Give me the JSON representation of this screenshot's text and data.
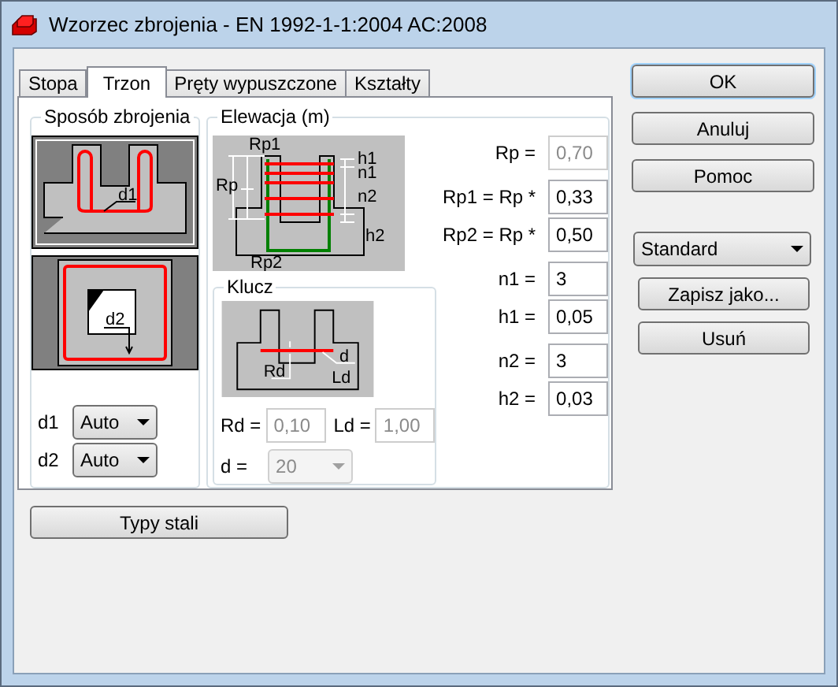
{
  "window": {
    "title": "Wzorzec zbrojenia - EN 1992-1-1:2004 AC:2008"
  },
  "tabs": [
    {
      "label": "Stopa",
      "selected": false
    },
    {
      "label": "Trzon",
      "selected": true
    },
    {
      "label": "Pręty wypuszczone",
      "selected": false
    },
    {
      "label": "Kształty",
      "selected": false
    }
  ],
  "method_group": {
    "title": "Sposób zbrojenia",
    "drawing_labels": [
      "d1",
      "d2"
    ],
    "selects": [
      {
        "label": "d1",
        "value": "Auto",
        "disabled": false
      },
      {
        "label": "d2",
        "value": "Auto",
        "disabled": false
      }
    ]
  },
  "elevation_group": {
    "title": "Elewacja (m)",
    "drawing_labels": [
      "Rp1",
      "Rp",
      "Rp2",
      "h1",
      "n1",
      "n2",
      "h2"
    ],
    "fields": [
      {
        "label": "Rp =",
        "value": "0,70",
        "disabled": true
      },
      {
        "label": "Rp1 = Rp *",
        "value": "0,33",
        "disabled": false
      },
      {
        "label": "Rp2 = Rp *",
        "value": "0,50",
        "disabled": false
      },
      {
        "label": "n1 =",
        "value": "3",
        "disabled": false
      },
      {
        "label": "h1 =",
        "value": "0,05",
        "disabled": false
      },
      {
        "label": "n2 =",
        "value": "3",
        "disabled": false
      },
      {
        "label": "h2 =",
        "value": "0,03",
        "disabled": false
      }
    ]
  },
  "key_group": {
    "title": "Klucz",
    "drawing_labels": [
      "d",
      "Rd",
      "Ld"
    ],
    "fields": [
      {
        "label": "Rd =",
        "value": "0,10",
        "disabled": true
      },
      {
        "label": "Ld =",
        "value": "1,00",
        "disabled": true
      }
    ],
    "select": {
      "label": "d =",
      "value": "20",
      "disabled": true
    }
  },
  "steel_button": "Typy stali",
  "dialog_buttons": [
    {
      "label": "OK",
      "default": true
    },
    {
      "label": "Anuluj",
      "default": false
    },
    {
      "label": "Pomoc",
      "default": false
    }
  ],
  "template": {
    "value": "Standard"
  },
  "template_buttons": [
    "Zapisz jako...",
    "Usuń"
  ]
}
